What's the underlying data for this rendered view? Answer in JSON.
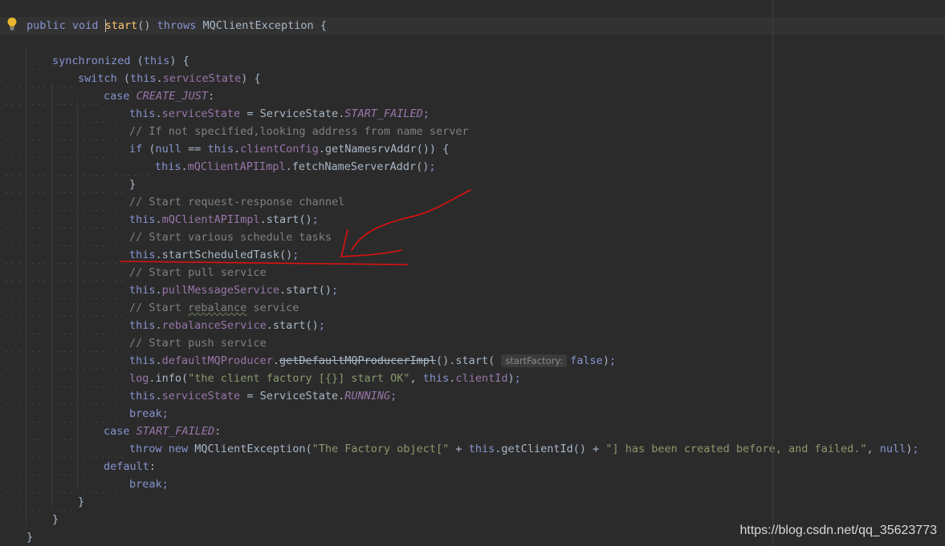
{
  "editor": {
    "lines": [
      {
        "segments": [
          {
            "t": "public",
            "c": "kwb"
          },
          {
            "t": " "
          },
          {
            "t": "void",
            "c": "kwb"
          },
          {
            "t": " "
          },
          {
            "t": "|caret|",
            "c": "caret"
          },
          {
            "t": "start",
            "c": "fn"
          },
          {
            "t": "() "
          },
          {
            "t": "throws",
            "c": "kwb"
          },
          {
            "t": " MQClientException {"
          }
        ]
      },
      {
        "segments": []
      },
      {
        "segments": [
          {
            "t": "synchronized",
            "c": "kwb"
          },
          {
            "t": " ("
          },
          {
            "t": "this",
            "c": "kwb"
          },
          {
            "t": ") {"
          }
        ]
      },
      {
        "segments": [
          {
            "t": "switch",
            "c": "kwb"
          },
          {
            "t": " ("
          },
          {
            "t": "this",
            "c": "kwb"
          },
          {
            "t": "."
          },
          {
            "t": "serviceState",
            "c": "field"
          },
          {
            "t": ") {"
          }
        ]
      },
      {
        "segments": [
          {
            "t": "case",
            "c": "kwb"
          },
          {
            "t": " "
          },
          {
            "t": "CREATE_JUST",
            "c": "field ital"
          },
          {
            "t": ":"
          }
        ]
      },
      {
        "segments": [
          {
            "t": "this",
            "c": "kwb"
          },
          {
            "t": "."
          },
          {
            "t": "serviceState",
            "c": "field"
          },
          {
            "t": " = ServiceState."
          },
          {
            "t": "START_FAILED",
            "c": "field ital"
          },
          {
            "t": ";",
            "c": "kwb"
          }
        ]
      },
      {
        "segments": [
          {
            "t": "// If not specified,looking address from name server",
            "c": "cmt"
          }
        ]
      },
      {
        "segments": [
          {
            "t": "if",
            "c": "kwb"
          },
          {
            "t": " ("
          },
          {
            "t": "null",
            "c": "kwb"
          },
          {
            "t": " == "
          },
          {
            "t": "this",
            "c": "kwb"
          },
          {
            "t": "."
          },
          {
            "t": "clientConfig",
            "c": "field"
          },
          {
            "t": ".getNamesrvAddr()) {"
          }
        ]
      },
      {
        "segments": [
          {
            "t": "this",
            "c": "kwb"
          },
          {
            "t": "."
          },
          {
            "t": "mQClientAPIImpl",
            "c": "field"
          },
          {
            "t": ".fetchNameServerAddr()"
          },
          {
            "t": ";",
            "c": "kwb"
          }
        ]
      },
      {
        "segments": [
          {
            "t": "}"
          }
        ]
      },
      {
        "segments": [
          {
            "t": "// Start request-response channel",
            "c": "cmt"
          }
        ]
      },
      {
        "segments": [
          {
            "t": "this",
            "c": "kwb"
          },
          {
            "t": "."
          },
          {
            "t": "mQClientAPIImpl",
            "c": "field"
          },
          {
            "t": ".start()"
          },
          {
            "t": ";",
            "c": "kwb"
          }
        ]
      },
      {
        "segments": [
          {
            "t": "// Start various schedule tasks",
            "c": "cmt"
          }
        ]
      },
      {
        "segments": [
          {
            "t": "this",
            "c": "kwb"
          },
          {
            "t": ".startScheduledTask()"
          },
          {
            "t": ";",
            "c": "kwb"
          }
        ]
      },
      {
        "segments": [
          {
            "t": "// Start pull service",
            "c": "cmt"
          }
        ]
      },
      {
        "segments": [
          {
            "t": "this",
            "c": "kwb"
          },
          {
            "t": "."
          },
          {
            "t": "pullMessageService",
            "c": "field"
          },
          {
            "t": ".start()"
          },
          {
            "t": ";",
            "c": "kwb"
          }
        ]
      },
      {
        "segments": [
          {
            "t": "// Start ",
            "c": "cmt"
          },
          {
            "t": "rebalance",
            "c": "cmt squig"
          },
          {
            "t": " service",
            "c": "cmt"
          }
        ]
      },
      {
        "segments": [
          {
            "t": "this",
            "c": "kwb"
          },
          {
            "t": "."
          },
          {
            "t": "rebalanceService",
            "c": "field"
          },
          {
            "t": ".start()"
          },
          {
            "t": ";",
            "c": "kwb"
          }
        ]
      },
      {
        "segments": [
          {
            "t": "// Start push service",
            "c": "cmt"
          }
        ]
      },
      {
        "segments": [
          {
            "t": "this",
            "c": "kwb"
          },
          {
            "t": "."
          },
          {
            "t": "defaultMQProducer",
            "c": "field"
          },
          {
            "t": "."
          },
          {
            "t": "getDefaultMQProducerImpl",
            "c": "strike"
          },
          {
            "t": "().start( "
          },
          {
            "t": "startFactory:",
            "c": "hint"
          },
          {
            "t": "false",
            "c": "kwb"
          },
          {
            "t": ")"
          },
          {
            "t": ";",
            "c": "kwb"
          }
        ]
      },
      {
        "segments": [
          {
            "t": "log",
            "c": "field"
          },
          {
            "t": ".info("
          },
          {
            "t": "\"the client factory [{}] start OK\"",
            "c": "str"
          },
          {
            "t": ", "
          },
          {
            "t": "this",
            "c": "kwb"
          },
          {
            "t": "."
          },
          {
            "t": "clientId",
            "c": "field"
          },
          {
            "t": ")"
          },
          {
            "t": ";",
            "c": "kwb"
          }
        ]
      },
      {
        "segments": [
          {
            "t": "this",
            "c": "kwb"
          },
          {
            "t": "."
          },
          {
            "t": "serviceState",
            "c": "field"
          },
          {
            "t": " = ServiceState."
          },
          {
            "t": "RUNNING",
            "c": "field ital"
          },
          {
            "t": ";",
            "c": "kwb"
          }
        ]
      },
      {
        "segments": [
          {
            "t": "break",
            "c": "kwb"
          },
          {
            "t": ";",
            "c": "kwb"
          }
        ]
      },
      {
        "segments": [
          {
            "t": "case",
            "c": "kwb"
          },
          {
            "t": " "
          },
          {
            "t": "START_FAILED",
            "c": "field ital"
          },
          {
            "t": ":"
          }
        ]
      },
      {
        "segments": [
          {
            "t": "throw",
            "c": "kwb"
          },
          {
            "t": " "
          },
          {
            "t": "new",
            "c": "kwb"
          },
          {
            "t": " MQClientException("
          },
          {
            "t": "\"The Factory object[\"",
            "c": "str"
          },
          {
            "t": " + "
          },
          {
            "t": "this",
            "c": "kwb"
          },
          {
            "t": ".getClientId() + "
          },
          {
            "t": "\"] has been created before, and failed.\"",
            "c": "str"
          },
          {
            "t": ", "
          },
          {
            "t": "null",
            "c": "kwb"
          },
          {
            "t": ")"
          },
          {
            "t": ";",
            "c": "kwb"
          }
        ]
      },
      {
        "segments": [
          {
            "t": "default",
            "c": "kwb"
          },
          {
            "t": ":"
          }
        ]
      },
      {
        "segments": [
          {
            "t": "break",
            "c": "kwb"
          },
          {
            "t": ";",
            "c": "kwb"
          }
        ]
      },
      {
        "segments": [
          {
            "t": "}"
          }
        ]
      },
      {
        "segments": [
          {
            "t": "}"
          }
        ]
      },
      {
        "segments": [
          {
            "t": "}"
          }
        ]
      }
    ]
  },
  "watermark": "https://blog.csdn.net/qq_35623773",
  "icons": {
    "gutter": "lightbulb-icon"
  },
  "colors": {
    "background": "#2b2b2b",
    "annotation": "#e01010"
  }
}
